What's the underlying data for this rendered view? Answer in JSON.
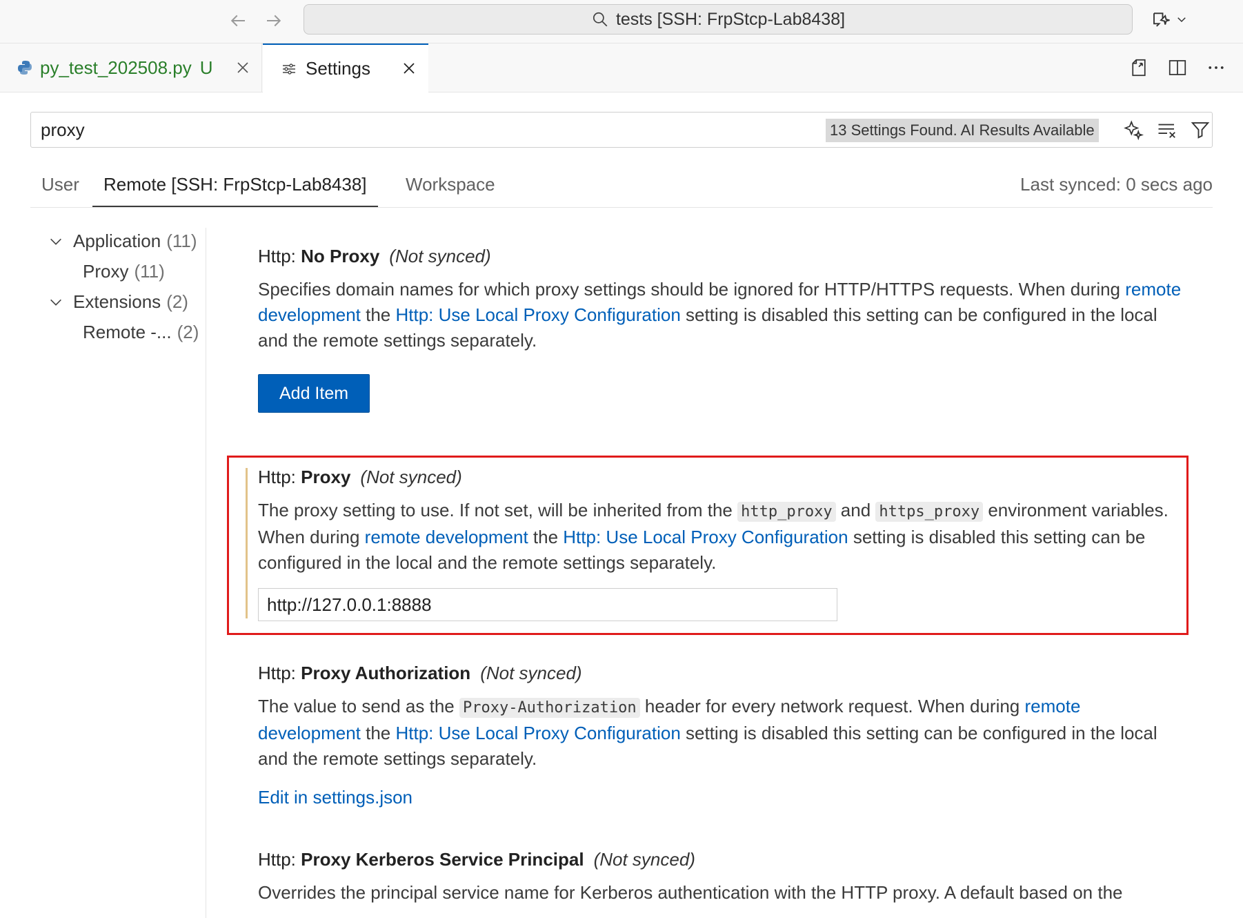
{
  "window": {
    "command_center_text": "tests [SSH: FrpStcp-Lab8438]"
  },
  "tabs": [
    {
      "label": "py_test_202508.py",
      "badge": "U"
    },
    {
      "label": "Settings"
    }
  ],
  "search": {
    "value": "proxy",
    "result_count": "13 Settings Found. AI Results Available"
  },
  "scopes": {
    "user": "User",
    "remote": "Remote [SSH: FrpStcp-Lab8438]",
    "workspace": "Workspace",
    "last_synced": "Last synced: 0 secs ago"
  },
  "toc": [
    {
      "label": "Application",
      "count": "(11)"
    },
    {
      "label": "Proxy",
      "count": "(11)"
    },
    {
      "label": "Extensions",
      "count": "(2)"
    },
    {
      "label": "Remote -...",
      "count": "(2)"
    }
  ],
  "settings": {
    "no_proxy": {
      "category": "Http: ",
      "name": "No Proxy",
      "status": "(Not synced)",
      "desc_1": "Specifies domain names for which proxy settings should be ignored for HTTP/HTTPS requests. When during ",
      "link_1": "remote development",
      "desc_2": " the ",
      "link_2": "Http: Use Local Proxy Configuration",
      "desc_3": " setting is disabled this setting can be configured in the local and the remote settings separately.",
      "button": "Add Item"
    },
    "proxy": {
      "category": "Http: ",
      "name": "Proxy",
      "status": "(Not synced)",
      "desc_1": "The proxy setting to use. If not set, will be inherited from the ",
      "code_1": "http_proxy",
      "desc_2": " and ",
      "code_2": "https_proxy",
      "desc_3": " environment variables. When during ",
      "link_1": "remote development",
      "desc_4": " the ",
      "link_2": "Http: Use Local Proxy Configuration",
      "desc_5": " setting is disabled this setting can be configured in the local and the remote settings separately.",
      "value": "http://127.0.0.1:8888"
    },
    "proxy_auth": {
      "category": "Http: ",
      "name": "Proxy Authorization",
      "status": "(Not synced)",
      "desc_1": "The value to send as the ",
      "code_1": "Proxy-Authorization",
      "desc_2": " header for every network request. When during ",
      "link_1": "remote development",
      "desc_3": " the ",
      "link_2": "Http: Use Local Proxy Configuration",
      "desc_4": " setting is disabled this setting can be configured in the local and the remote settings separately.",
      "edit_link": "Edit in settings.json"
    },
    "kerberos": {
      "category": "Http: ",
      "name": "Proxy Kerberos Service Principal",
      "status": "(Not synced)",
      "desc_1": "Overrides the principal service name for Kerberos authentication with the HTTP proxy. A default based on the"
    }
  },
  "colors": {
    "accent": "#005fb8",
    "highlight_border": "#e01b1b",
    "modified_indicator": "#e2c38a"
  }
}
